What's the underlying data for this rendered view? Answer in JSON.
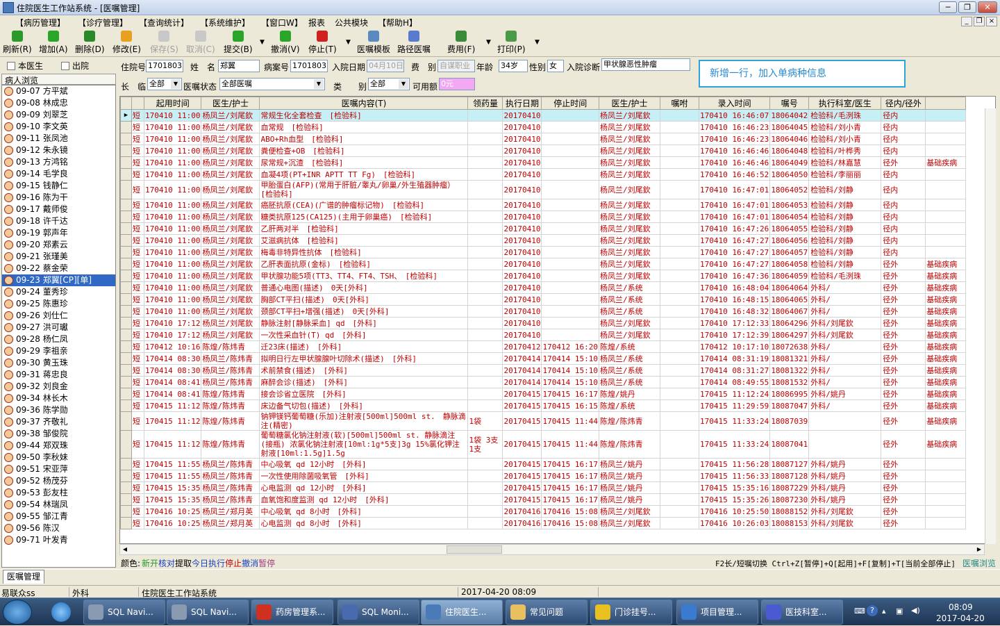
{
  "window": {
    "title": "住院医生工作站系统 - [医嘱管理]",
    "min": "─",
    "max": "❐",
    "close": "✕"
  },
  "menu": [
    "【病历管理】",
    "【诊疗管理】",
    "【查询统计】",
    "【系统维护】",
    "【窗口W】",
    "报表",
    "公共模块",
    "【帮助H】"
  ],
  "mdi": [
    "_",
    "❐",
    "×"
  ],
  "toolbar": [
    {
      "label": "刷新(R)",
      "icon": "refresh-icon",
      "color": "#2a9a2a",
      "disabled": false
    },
    {
      "label": "增加(A)",
      "icon": "add-icon",
      "color": "#2aa52a",
      "disabled": false
    },
    {
      "label": "删除(D)",
      "icon": "delete-icon",
      "color": "#2a8a2a",
      "disabled": false
    },
    {
      "label": "修改(E)",
      "icon": "edit-icon",
      "color": "#e8a020",
      "disabled": false
    },
    {
      "label": "保存(S)",
      "icon": "save-icon",
      "color": "#c8c8c8",
      "disabled": true
    },
    {
      "label": "取消(C)",
      "icon": "cancel-icon",
      "color": "#c8c8c8",
      "disabled": true
    },
    {
      "label": "提交(B)",
      "icon": "submit-icon",
      "color": "#2aa52a",
      "disabled": false
    },
    {
      "label": "撤消(V)",
      "icon": "undo-icon",
      "color": "#2aa52a",
      "disabled": false
    },
    {
      "label": "停止(T)",
      "icon": "stop-icon",
      "color": "#d02020",
      "disabled": false
    },
    {
      "label": "医嘱模板",
      "icon": "template-icon",
      "color": "#5a8ac0",
      "disabled": false
    },
    {
      "label": "路径医嘱",
      "icon": "path-order-icon",
      "color": "#5a7ad0",
      "disabled": false
    },
    {
      "label": "费用(F)",
      "icon": "fee-icon",
      "color": "#3a8a3a",
      "disabled": false
    },
    {
      "label": "打印(P)",
      "icon": "print-icon",
      "color": "#4a9a4a",
      "disabled": false
    }
  ],
  "left": {
    "cb1": "本医生",
    "cb2": "出院",
    "header": "病人浏览"
  },
  "patients": [
    {
      "bed": "09-07",
      "name": "方平斌"
    },
    {
      "bed": "09-08",
      "name": "林成忠"
    },
    {
      "bed": "09-09",
      "name": "刘翠芝"
    },
    {
      "bed": "09-10",
      "name": "李文英"
    },
    {
      "bed": "09-11",
      "name": "张凤池"
    },
    {
      "bed": "09-12",
      "name": "朱永镜"
    },
    {
      "bed": "09-13",
      "name": "方鸿铭"
    },
    {
      "bed": "09-14",
      "name": "毛学良"
    },
    {
      "bed": "09-15",
      "name": "钱静仁"
    },
    {
      "bed": "09-16",
      "name": "陈为干"
    },
    {
      "bed": "09-17",
      "name": "戴师俊"
    },
    {
      "bed": "09-18",
      "name": "许千达"
    },
    {
      "bed": "09-19",
      "name": "郭声年"
    },
    {
      "bed": "09-20",
      "name": "郑素云"
    },
    {
      "bed": "09-21",
      "name": "张瑾美"
    },
    {
      "bed": "09-22",
      "name": "蔡金荣"
    },
    {
      "bed": "09-23",
      "name": "郑翼[CP][单]",
      "sel": true
    },
    {
      "bed": "09-24",
      "name": "董秀珍"
    },
    {
      "bed": "09-25",
      "name": "陈惠珍"
    },
    {
      "bed": "09-26",
      "name": "刘仕仁"
    },
    {
      "bed": "09-27",
      "name": "洪可瓛"
    },
    {
      "bed": "09-28",
      "name": "杨仁凤"
    },
    {
      "bed": "09-29",
      "name": "李祖亲"
    },
    {
      "bed": "09-30",
      "name": "黄玉珠"
    },
    {
      "bed": "09-31",
      "name": "蒋忠良"
    },
    {
      "bed": "09-32",
      "name": "刘良金"
    },
    {
      "bed": "09-34",
      "name": "林长木"
    },
    {
      "bed": "09-36",
      "name": "陈学勋"
    },
    {
      "bed": "09-37",
      "name": "齐敬礼"
    },
    {
      "bed": "09-38",
      "name": "邹俊院"
    },
    {
      "bed": "09-44",
      "name": "郑双珠"
    },
    {
      "bed": "09-50",
      "name": "李秋妹"
    },
    {
      "bed": "09-51",
      "name": "宋亚萍"
    },
    {
      "bed": "09-52",
      "name": "杨茂芬"
    },
    {
      "bed": "09-53",
      "name": "彭友柱"
    },
    {
      "bed": "09-54",
      "name": "林瑞凤"
    },
    {
      "bed": "09-55",
      "name": "邹江青"
    },
    {
      "bed": "09-56",
      "name": "陈汉"
    },
    {
      "bed": "09-71",
      "name": "叶发青"
    }
  ],
  "filters": {
    "inp_no_label": "住院号",
    "inp_no": "1701803",
    "name_label": "姓　名",
    "name": "郑翼",
    "case_label": "病案号",
    "case_no": "1701803",
    "admit_label": "入院日期",
    "admit_date": "04月10日",
    "fee_label": "费　别",
    "fee_type": "自谋职业",
    "age_label": "年龄",
    "age": "34岁",
    "sex_label": "性别",
    "sex": "女",
    "diag_label": "入院诊断",
    "diag": "甲状腺恶性肿瘤",
    "long_label": "长　临",
    "long_val": "全部",
    "status_label": "医嘱状态",
    "status_val": "全部医嘱",
    "type_label": "类　　别",
    "type_val": "全部",
    "avail_label": "可用额",
    "avail_val": "0元"
  },
  "notice": "新增一行，加入单病种信息",
  "columns": [
    "起用时间",
    "医生/护士",
    "医嘱内容(T)",
    "领药量",
    "执行日期",
    "停止时间",
    "医生/护士",
    "嘱咐",
    "录入时间",
    "嘱号",
    "执行科室/医生",
    "径内/径外",
    ""
  ],
  "rows": [
    [
      "短",
      "170410 11:00",
      "杨凤兰/刘尾欽",
      "常规生化全套检查　[检验科]",
      "",
      "20170410",
      "",
      "杨凤兰/刘尾欽",
      "",
      "170410 16:46:07",
      "18064042",
      "检验科/毛洌珠",
      "径内",
      ""
    ],
    [
      "短",
      "170410 11:00",
      "杨凤兰/刘尾欽",
      "血常规　[检验科]",
      "",
      "20170410",
      "",
      "杨凤兰/刘尾欽",
      "",
      "170410 16:46:23",
      "18064045",
      "检验科/刘小青",
      "径内",
      ""
    ],
    [
      "短",
      "170410 11:00",
      "杨凤兰/刘尾欽",
      "ABO+Rh血型　[检验科]",
      "",
      "20170410",
      "",
      "杨凤兰/刘尾欽",
      "",
      "170410 16:46:23",
      "18064046",
      "检验科/刘小青",
      "径内",
      ""
    ],
    [
      "短",
      "170410 11:00",
      "杨凤兰/刘尾欽",
      "粪便检查+OB　[检验科]",
      "",
      "20170410",
      "",
      "杨凤兰/刘尾欽",
      "",
      "170410 16:46:46",
      "18064048",
      "检验科/叶桦秀",
      "径内",
      ""
    ],
    [
      "短",
      "170410 11:00",
      "杨凤兰/刘尾欽",
      "尿常规+沉渣　[检验科]",
      "",
      "20170410",
      "",
      "杨凤兰/刘尾欽",
      "",
      "170410 16:46:46",
      "18064049",
      "检验科/林嘉慧",
      "径外",
      "基础疾病"
    ],
    [
      "短",
      "170410 11:00",
      "杨凤兰/刘尾欽",
      "血凝4项(PT+INR APTT TT Fg)　[检验科]",
      "",
      "20170410",
      "",
      "杨凤兰/刘尾欽",
      "",
      "170410 16:46:52",
      "18064050",
      "检验科/李丽丽",
      "径内",
      ""
    ],
    [
      "短",
      "170410 11:00",
      "杨凤兰/刘尾欽",
      "甲胎蛋白(AFP)(常用于肝脏/睾丸/卵巢/外生殖器肿瘤）　[检验科]",
      "",
      "20170410",
      "",
      "杨凤兰/刘尾欽",
      "",
      "170410 16:47:01",
      "18064052",
      "检验科/刘静",
      "径内",
      ""
    ],
    [
      "短",
      "170410 11:00",
      "杨凤兰/刘尾欽",
      "癌胚抗原(CEA)(广谱的肿瘤标记物)　[检验科]",
      "",
      "20170410",
      "",
      "杨凤兰/刘尾欽",
      "",
      "170410 16:47:01",
      "18064053",
      "检验科/刘静",
      "径内",
      ""
    ],
    [
      "短",
      "170410 11:00",
      "杨凤兰/刘尾欽",
      "糖类抗原125(CA125)(主用于卵巢癌)　[检验科]",
      "",
      "20170410",
      "",
      "杨凤兰/刘尾欽",
      "",
      "170410 16:47:01",
      "18064054",
      "检验科/刘静",
      "径内",
      ""
    ],
    [
      "短",
      "170410 11:00",
      "杨凤兰/刘尾欽",
      "乙肝两对半　[检验科]",
      "",
      "20170410",
      "",
      "杨凤兰/刘尾欽",
      "",
      "170410 16:47:26",
      "18064055",
      "检验科/刘静",
      "径内",
      ""
    ],
    [
      "短",
      "170410 11:00",
      "杨凤兰/刘尾欽",
      "艾滋病抗体　[检验科]",
      "",
      "20170410",
      "",
      "杨凤兰/刘尾欽",
      "",
      "170410 16:47:27",
      "18064056",
      "检验科/刘静",
      "径内",
      ""
    ],
    [
      "短",
      "170410 11:00",
      "杨凤兰/刘尾欽",
      "梅毒非特异性抗体　[检验科]",
      "",
      "20170410",
      "",
      "杨凤兰/刘尾欽",
      "",
      "170410 16:47:27",
      "18064057",
      "检验科/刘静",
      "径内",
      ""
    ],
    [
      "短",
      "170410 11:00",
      "杨凤兰/刘尾欽",
      "乙肝表面抗原(金标)　[检验科]",
      "",
      "20170410",
      "",
      "杨凤兰/刘尾欽",
      "",
      "170410 16:47:27",
      "18064058",
      "检验科/刘静",
      "径外",
      "基础疾病"
    ],
    [
      "短",
      "170410 11:00",
      "杨凤兰/刘尾欽",
      "甲状腺功能5项(TT3、TT4、FT4、TSH、　[检验科]",
      "",
      "20170410",
      "",
      "杨凤兰/刘尾欽",
      "",
      "170410 16:47:36",
      "18064059",
      "检验科/毛洌珠",
      "径外",
      "基础疾病"
    ],
    [
      "短",
      "170410 11:00",
      "杨凤兰/刘尾欽",
      "普通心电图(描述)　0天[外科]",
      "",
      "20170410",
      "",
      "杨凤兰/系统",
      "",
      "170410 16:48:04",
      "18064064",
      "外科/",
      "径外",
      "基础疾病"
    ],
    [
      "短",
      "170410 11:00",
      "杨凤兰/刘尾欽",
      "胸部CT平扫(描述)　0天[外科]",
      "",
      "20170410",
      "",
      "杨凤兰/系统",
      "",
      "170410 16:48:15",
      "18064065",
      "外科/",
      "径外",
      "基础疾病"
    ],
    [
      "短",
      "170410 11:00",
      "杨凤兰/刘尾欽",
      "颈部CT平扫+增强(描述)　0天[外科]",
      "",
      "20170410",
      "",
      "杨凤兰/系统",
      "",
      "170410 16:48:32",
      "18064067",
      "外科/",
      "径外",
      "基础疾病"
    ],
    [
      "短",
      "170410 17:12",
      "杨凤兰/刘尾欽",
      "静脉注射[静脉采血] qd　[外科]",
      "",
      "20170410",
      "",
      "杨凤兰/刘尾欽",
      "",
      "170410 17:12:33",
      "18064296",
      "外科/刘尾欽",
      "径外",
      "基础疾病"
    ],
    [
      "短",
      "170410 17:12",
      "杨凤兰/刘尾欽",
      "一次性采血针(T) qd　[外科]",
      "",
      "20170410",
      "",
      "杨凤兰/刘尾欽",
      "",
      "170410 17:12:39",
      "18064297",
      "外科/刘尾欽",
      "径外",
      "基础疾病"
    ],
    [
      "短",
      "170412 10:16",
      "陈煌/陈炜青",
      "迁23床(描述)　[外科]",
      "",
      "20170412",
      "170412 16:20",
      "陈煌/系统",
      "",
      "170412 10:17:10",
      "18072638",
      "外科/",
      "径外",
      "基础疾病"
    ],
    [
      "短",
      "170414 08:30",
      "杨凤兰/陈炜青",
      "拟明日行左甲状腺腺叶切除术(描述)　[外科]",
      "",
      "20170414",
      "170414 15:10",
      "杨凤兰/系统",
      "",
      "170414 08:31:19",
      "18081321",
      "外科/",
      "径外",
      "基础疾病"
    ],
    [
      "短",
      "170414 08:30",
      "杨凤兰/陈炜青",
      "术前禁食(描述)　[外科]",
      "",
      "20170414",
      "170414 15:10",
      "杨凤兰/系统",
      "",
      "170414 08:31:27",
      "18081322",
      "外科/",
      "径外",
      "基础疾病"
    ],
    [
      "短",
      "170414 08:41",
      "杨凤兰/陈炜青",
      "麻醉会诊(描述)　[外科]",
      "",
      "20170414",
      "170414 15:10",
      "杨凤兰/系统",
      "",
      "170414 08:49:55",
      "18081532",
      "外科/",
      "径外",
      "基础疾病"
    ],
    [
      "短",
      "170414 08:41",
      "陈煌/陈炜青",
      "接会诊省立医院　[外科]",
      "",
      "20170415",
      "170415 16:17",
      "陈煌/姚丹",
      "",
      "170415 11:12:24",
      "18086995",
      "外科/姚丹",
      "径外",
      "基础疾病"
    ],
    [
      "短",
      "170415 11:12",
      "陈煌/陈炜青",
      "床边备气切包(描述)　[外科]",
      "",
      "20170415",
      "170415 16:15",
      "陈煌/系统",
      "",
      "170415 11:29:59",
      "18087047",
      "外科/",
      "径外",
      "基础疾病"
    ],
    [
      "短",
      "170415 11:12",
      "陈煌/陈炜青",
      "钠钾镁钙葡萄糖(乐加)注射液[500ml]500ml st.　静脉滴注(精密)",
      "1袋",
      "20170415",
      "170415 11:44",
      "陈煌/陈炜青",
      "",
      "170415 11:33:24",
      "18087039",
      "",
      "径外",
      "基础疾病"
    ],
    [
      "短",
      "170415 11:12",
      "陈煌/陈炜青",
      "葡萄糖氯化钠注射液(软)[500ml]500ml st. 静脉滴注(接瓶) 浓氯化钠注射液[10ml:1g*5支]3g 15%氯化钾注射液[10ml:1.5g]1.5g",
      "1袋 3支 1支",
      "20170415",
      "170415 11:44",
      "陈煌/陈炜青",
      "",
      "170415 11:33:24",
      "18087041",
      "",
      "径外",
      "基础疾病"
    ],
    [
      "短",
      "170415 11:55",
      "杨凤兰/陈炜青",
      "中心吸氧 qd 12小时　[外科]",
      "",
      "20170415",
      "170415 16:17",
      "杨凤兰/姚丹",
      "",
      "170415 11:56:28",
      "18087127",
      "外科/姚丹",
      "径外",
      ""
    ],
    [
      "短",
      "170415 11:55",
      "杨凤兰/陈炜青",
      "一次性使用除菌吸氧管　[外科]",
      "",
      "20170415",
      "170415 16:17",
      "杨凤兰/姚丹",
      "",
      "170415 11:56:33",
      "18087128",
      "外科/姚丹",
      "径外",
      ""
    ],
    [
      "短",
      "170415 15:35",
      "杨凤兰/陈炜青",
      "心电监测 qd 12小时　[外科]",
      "",
      "20170415",
      "170415 16:17",
      "杨凤兰/姚丹",
      "",
      "170415 15:35:16",
      "18087229",
      "外科/姚丹",
      "径外",
      ""
    ],
    [
      "短",
      "170415 15:35",
      "杨凤兰/陈炜青",
      "血氧饱和度监测 qd 12小时　[外科]",
      "",
      "20170415",
      "170415 16:17",
      "杨凤兰/姚丹",
      "",
      "170415 15:35:26",
      "18087230",
      "外科/姚丹",
      "径外",
      ""
    ],
    [
      "短",
      "170416 10:25",
      "杨凤兰/郑月英",
      "中心吸氧 qd 8小时　[外科]",
      "",
      "20170416",
      "170416 15:08",
      "杨凤兰/刘尾欽",
      "",
      "170416 10:25:50",
      "18088152",
      "外科/刘尾欽",
      "径外",
      ""
    ],
    [
      "短",
      "170416 10:25",
      "杨凤兰/郑月英",
      "心电监测 qd 8小时　[外科]",
      "",
      "20170416",
      "170416 15:08",
      "杨凤兰/刘尾欽",
      "",
      "170416 10:26:03",
      "18088153",
      "外科/刘尾欽",
      "径外",
      ""
    ]
  ],
  "legend": {
    "label": "颜色:",
    "items": [
      {
        "t": "新开",
        "c": "#2a9a2a"
      },
      {
        "t": "核对",
        "c": "#1a40c0"
      },
      {
        "t": "提取",
        "c": "#000000"
      },
      {
        "t": "今日执行",
        "c": "#1a40c0"
      },
      {
        "t": "停止",
        "c": "#c00000"
      },
      {
        "t": "撤消",
        "c": "#1a40c0"
      },
      {
        "t": "暂停",
        "c": "#a04080"
      }
    ],
    "hint": "F2长/短嘱切换 Ctrl+Z[暂停]+Q[起用]+F[复制]+T[当前全部停止]",
    "browse": "医嘱浏览"
  },
  "tab": "医嘱管理",
  "status": {
    "user": "易联众ss",
    "dept": "外科",
    "system": "住院医生工作站系统",
    "datetime": "2017-04-20 08:09"
  },
  "taskbar": [
    {
      "label": "SQL Navi...",
      "icon": "sql-navigator-icon",
      "color": "#8a9ab0"
    },
    {
      "label": "SQL Navi...",
      "icon": "sql-navigator-icon",
      "color": "#8a9ab0"
    },
    {
      "label": "药房管理系...",
      "icon": "pharmacy-icon",
      "color": "#d03020"
    },
    {
      "label": "SQL Moni...",
      "icon": "sql-monitor-icon",
      "color": "#4a6ab0"
    },
    {
      "label": "住院医生...",
      "icon": "doctor-station-icon",
      "color": "#4a7ab8",
      "active": true
    },
    {
      "label": "常见问题",
      "icon": "folder-icon",
      "color": "#e8c060"
    },
    {
      "label": "门诊挂号...",
      "icon": "registration-icon",
      "color": "#e8c020"
    },
    {
      "label": "项目管理...",
      "icon": "project-icon",
      "color": "#3a7ad0"
    },
    {
      "label": "医技科室...",
      "icon": "medtech-icon",
      "color": "#4a5ad0"
    }
  ],
  "clock": {
    "time": "08:09",
    "date": "2017-04-20"
  }
}
